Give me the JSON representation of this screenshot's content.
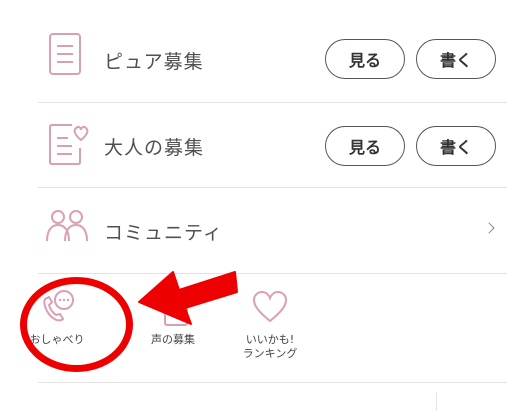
{
  "rows": [
    {
      "label": "ピュア募集",
      "view": "見る",
      "write": "書く"
    },
    {
      "label": "大人の募集",
      "view": "見る",
      "write": "書く"
    },
    {
      "label": "コミュニティ"
    }
  ],
  "bottom": [
    {
      "label": "おしゃべり"
    },
    {
      "label": "声の募集"
    },
    {
      "line1": "いいかも!",
      "line2": "ランキング"
    }
  ],
  "colors": {
    "accent_pink": "#d9a0b4",
    "annotation_red": "#ee0000"
  }
}
